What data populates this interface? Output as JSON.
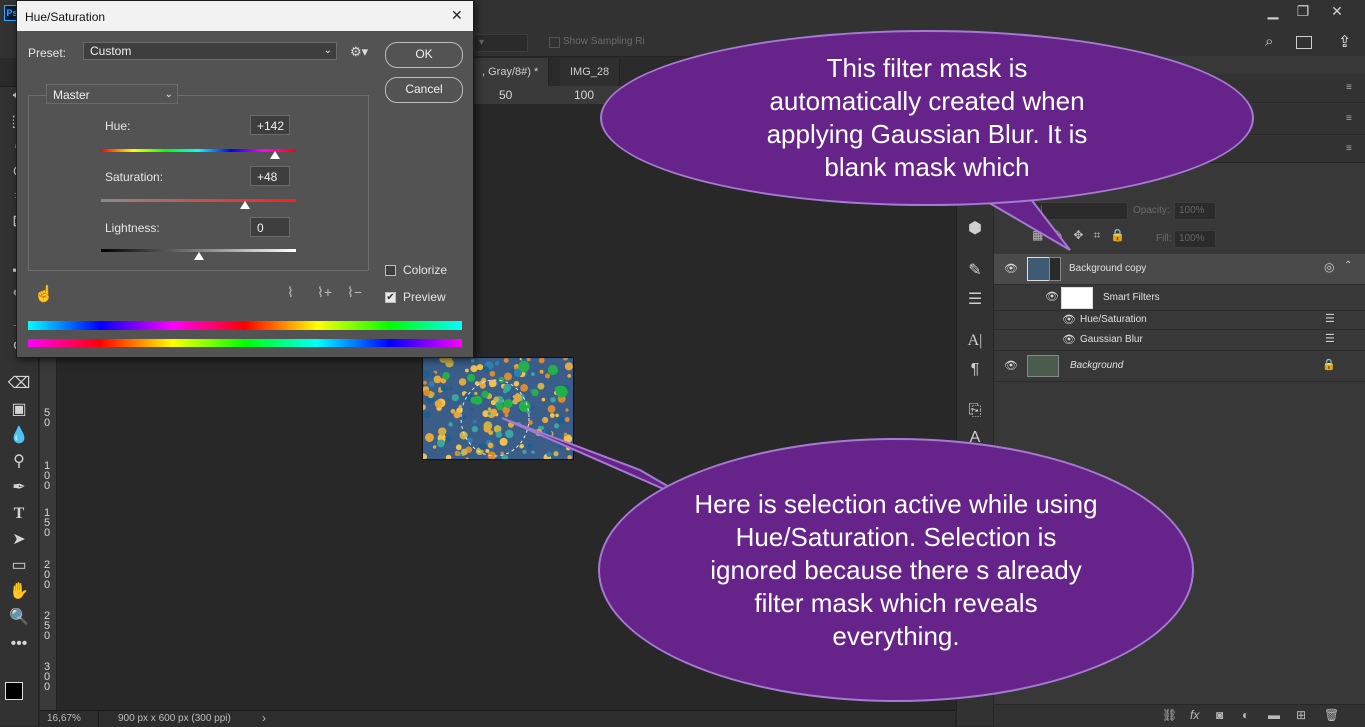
{
  "app": {
    "logo_text": "Ps",
    "option_bar": {
      "sample_checkbox_label": "Show Sampling Ri"
    }
  },
  "document": {
    "tabs": [
      {
        "label": ", Gray/8#) *"
      },
      {
        "label": "IMG_28"
      }
    ],
    "ruler_h_labels": [
      "50",
      "100"
    ],
    "ruler_v_labels": [
      "5\n0",
      "1\n0\n0",
      "1\n5\n0",
      "2\n0\n0",
      "2\n5\n0",
      "3\n0\n0"
    ],
    "zoom": "16,67%",
    "doc_size": "900 px x 600 px (300 ppi)",
    "status_arrow": "›"
  },
  "dialog": {
    "title": "Hue/Saturation",
    "close_glyph": "✕",
    "preset_label": "Preset:",
    "preset_value": "Custom",
    "ok_label": "OK",
    "cancel_label": "Cancel",
    "channel_value": "Master",
    "hue_label": "Hue:",
    "hue_value": "+142",
    "saturation_label": "Saturation:",
    "saturation_value": "+48",
    "lightness_label": "Lightness:",
    "lightness_value": "0",
    "colorize_label": "Colorize",
    "colorize_checked": false,
    "preview_label": "Preview",
    "preview_checked": true,
    "hue_slider_level": 0.89,
    "saturation_slider_level": 0.74,
    "lightness_slider_level": 0.5
  },
  "layers_panel": {
    "blend_mode": "rmal",
    "opacity_label": "Opacity:",
    "opacity_value": "100%",
    "fill_label": "Fill:",
    "fill_value": "100%",
    "layers": [
      {
        "name": "Background copy"
      },
      {
        "name": "Smart Filters"
      },
      {
        "name": "Hue/Saturation"
      },
      {
        "name": "Gaussian Blur"
      },
      {
        "name": "Background"
      }
    ]
  },
  "callouts": {
    "top": "This filter mask is automatically created when applying Gaussian Blur. It is blank mask which",
    "bottom": "Here is selection active while using Hue/Saturation. Selection is ignored because there s already filter mask which reveals everything."
  },
  "colors": {
    "callout_fill": "#66248b",
    "callout_border": "#a47bd0",
    "panel_bg": "#383838",
    "dialog_bg": "#535353"
  }
}
